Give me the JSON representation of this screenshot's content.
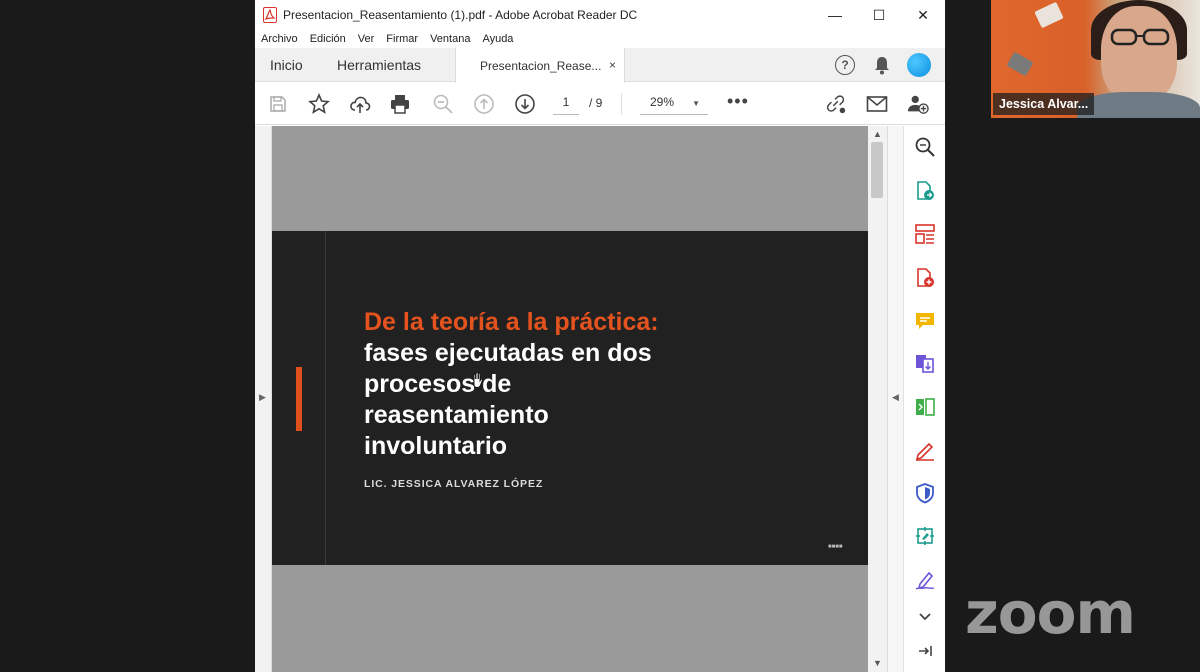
{
  "window": {
    "title": "Presentacion_Reasentamiento (1).pdf - Adobe Acrobat Reader DC",
    "minimize": "—",
    "maximize": "☐",
    "close": "✕"
  },
  "menu": [
    "Archivo",
    "Edición",
    "Ver",
    "Firmar",
    "Ventana",
    "Ayuda"
  ],
  "tabs": {
    "home": "Inicio",
    "tools": "Herramientas",
    "document": "Presentacion_Rease...",
    "close": "×"
  },
  "header_icons": {
    "help": "?"
  },
  "toolbar": {
    "page_current": "1",
    "page_total": "/ 9",
    "zoom": "29%",
    "zoom_caret": "▼",
    "more": "•••"
  },
  "slide": {
    "title_accent": "De la teoría a la práctica:",
    "title_line2": "fases ejecutadas en dos",
    "title_line3": "procesos de",
    "title_line4": "reasentamiento",
    "title_line5": "involuntario",
    "author": "LIC. JESSICA ALVAREZ LÓPEZ",
    "mark": "■■■■"
  },
  "scroll": {
    "left_arrow": "▶",
    "right_arrow": "◀",
    "up": "▲",
    "down": "▼"
  },
  "zoom_meeting": {
    "participant_name": "Jessica Alvar...",
    "logo": "zoom"
  },
  "colors": {
    "accent": "#e4531e",
    "slide_bg": "#222121",
    "acrobat_red": "#d9342b"
  }
}
